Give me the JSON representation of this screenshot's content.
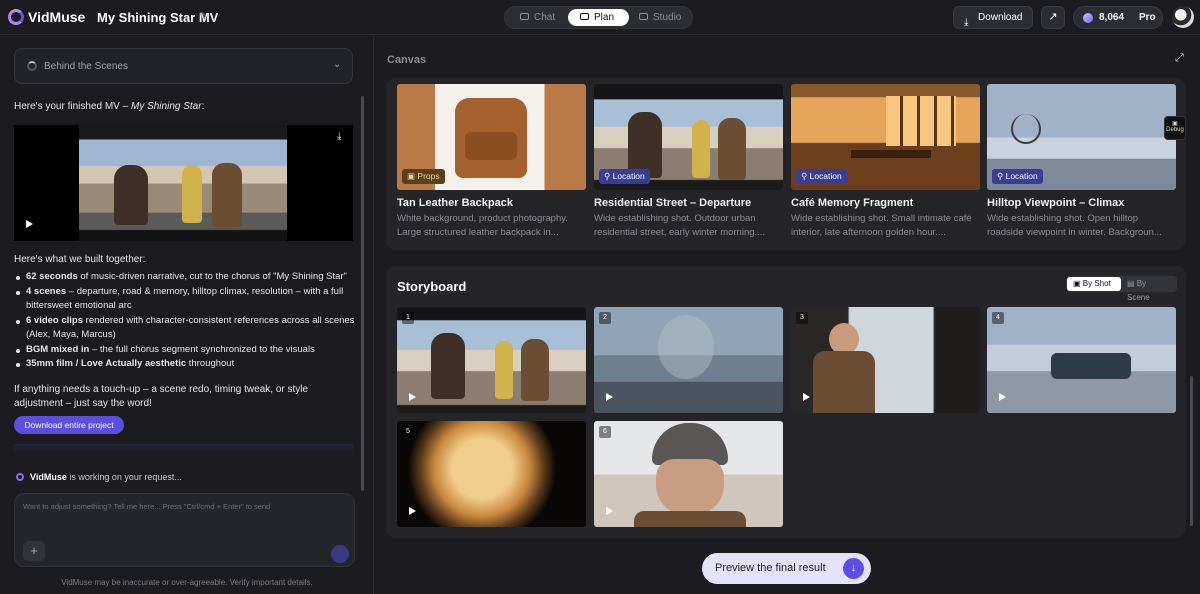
{
  "header": {
    "brand": "VidMuse",
    "project_title": "My Shining Star MV",
    "tabs": [
      {
        "label": "Chat",
        "active": false
      },
      {
        "label": "Plan",
        "active": true
      },
      {
        "label": "Studio",
        "active": false
      }
    ],
    "download_label": "Download",
    "credits": "8,064",
    "plan": "Pro"
  },
  "chat": {
    "behind_scenes": "Behind the Scenes",
    "intro_prefix": "Here's your finished MV – ",
    "intro_title": "My Shining Star",
    "intro_suffix": ":",
    "built_heading": "Here's what we built together:",
    "bullets": [
      {
        "bold": "62 seconds",
        "rest": " of music-driven narrative, cut to the chorus of \"My Shining Star\""
      },
      {
        "bold": "4 scenes",
        "rest": " – departure, road & memory, hilltop climax, resolution – with a full bittersweet emotional arc"
      },
      {
        "bold": "6 video clips",
        "rest": " rendered with character-consistent references across all scenes (Alex, Maya, Marcus)"
      },
      {
        "bold": "BGM mixed in",
        "rest": " – the full chorus segment synchronized to the visuals"
      },
      {
        "bold": "35mm film / Love Actually aesthetic",
        "rest": " throughout"
      }
    ],
    "touch_up": "If anything needs a touch-up – a scene redo, timing tweak, or style adjustment – just say the word!",
    "download_project": "Download entire project",
    "working_brand": "VidMuse",
    "working_text": " is working on your request...",
    "input_placeholder": "Want to adjust something? Tell me here... Press \"Ctrl/cmd + Enter\" to send",
    "disclaimer": "VidMuse may be inaccurate or over-agreeable. Verify important details."
  },
  "canvas": {
    "title": "Canvas",
    "debug_label": "Debug",
    "cards": [
      {
        "tag": "Props",
        "title": "Tan Leather Backpack",
        "desc": "White background, product photography. Large structured leather backpack in..."
      },
      {
        "tag": "Location",
        "title": "Residential Street – Departure",
        "desc": "Wide establishing shot. Outdoor urban residential street, early winter morning...."
      },
      {
        "tag": "Location",
        "title": "Café Memory Fragment",
        "desc": "Wide establishing shot. Small intimate café interior, late afternoon golden hour...."
      },
      {
        "tag": "Location",
        "title": "Hilltop Viewpoint – Climax",
        "desc": "Wide establishing shot. Open hilltop roadside viewpoint in winter. Backgroun..."
      }
    ]
  },
  "storyboard": {
    "title": "Storyboard",
    "toggle": [
      {
        "label": "By Shot",
        "active": true
      },
      {
        "label": "By Scene",
        "active": false
      }
    ],
    "shots": [
      "1",
      "2",
      "3",
      "4",
      "5",
      "6"
    ]
  },
  "preview_label": "Preview the final result",
  "colors": {
    "accent": "#5b4ee6",
    "location_tag": "#3a3d96",
    "props_tag": "#5a3f1c"
  }
}
